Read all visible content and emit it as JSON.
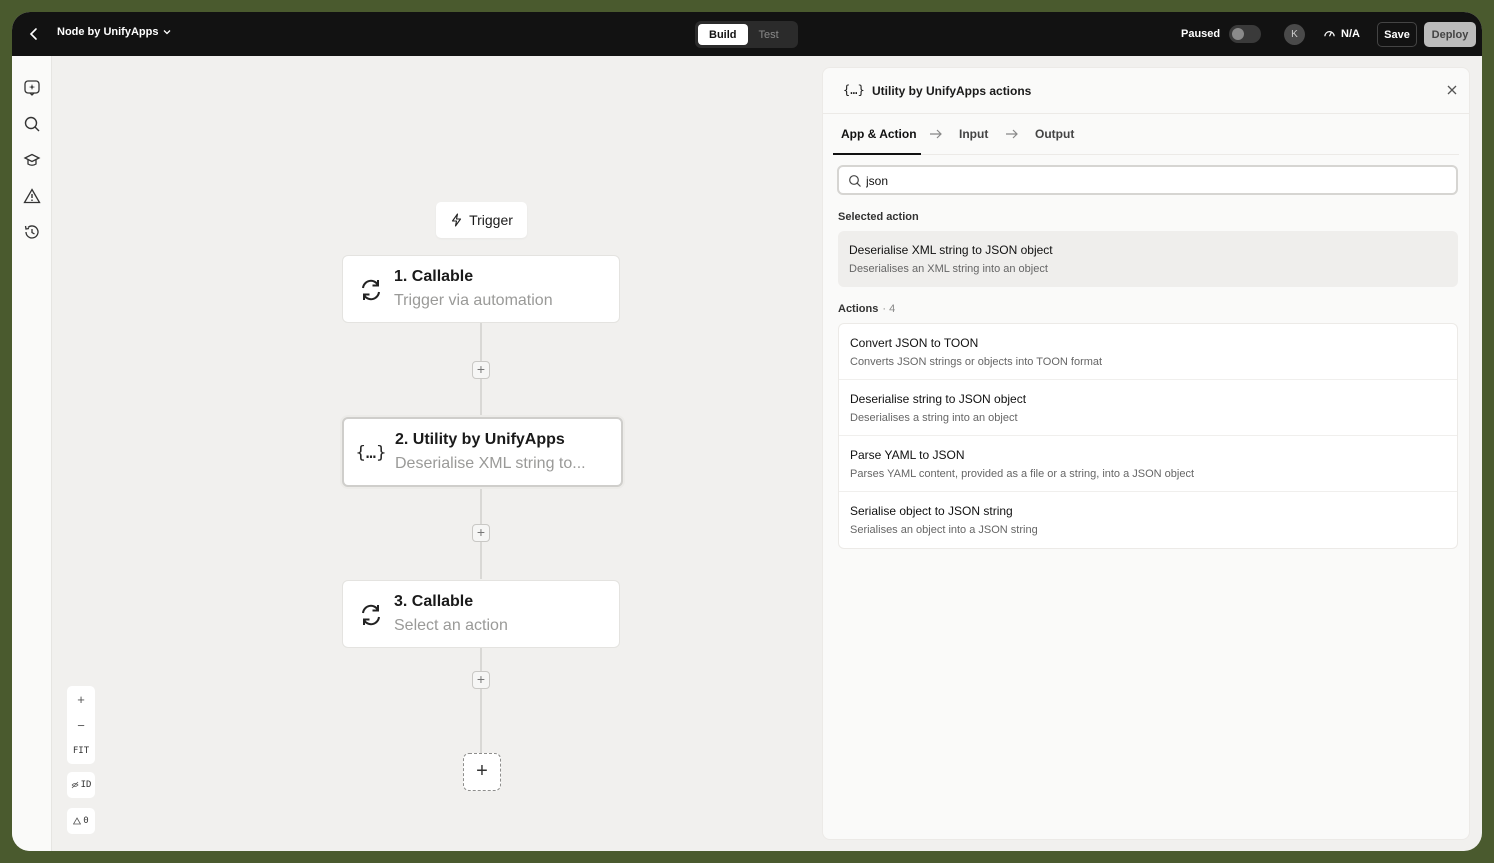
{
  "topbar": {
    "app_title": "Node by UnifyApps",
    "modes": [
      "Build",
      "Test"
    ],
    "paused_label": "Paused",
    "avatar_initial": "K",
    "perf_label": "N/A",
    "save_label": "Save",
    "deploy_label": "Deploy"
  },
  "rail": {
    "icons": [
      "sparkle-chat-icon",
      "search-icon",
      "graduation-cap-icon",
      "warning-icon",
      "history-icon"
    ]
  },
  "canvas": {
    "trigger_label": "Trigger",
    "nodes": [
      {
        "title": "1. Callable",
        "subtitle": "Trigger via automation",
        "icon": "sync-icon"
      },
      {
        "title": "2. Utility by UnifyApps",
        "subtitle": "Deserialise XML string to...",
        "icon": "braces-icon"
      },
      {
        "title": "3. Callable",
        "subtitle": "Select an action",
        "icon": "sync-icon"
      }
    ],
    "zoom_in": "+",
    "zoom_out": "−",
    "fit_label": "FIT",
    "id_label": "ID",
    "warnings_count": "0"
  },
  "panel": {
    "brace_glyph": "{…}",
    "title": "Utility by UnifyApps actions",
    "tabs": [
      "App & Action",
      "Input",
      "Output"
    ],
    "search": {
      "value": "json",
      "placeholder": ""
    },
    "selected_label": "Selected action",
    "selected_action": {
      "title": "Deserialise XML string to JSON object",
      "desc": "Deserialises an XML string into an object"
    },
    "actions_label": "Actions",
    "actions_count": "4",
    "actions": [
      {
        "title": "Convert JSON to TOON",
        "desc": "Converts JSON strings or objects into TOON format"
      },
      {
        "title": "Deserialise string to JSON object",
        "desc": "Deserialises a string into an object"
      },
      {
        "title": "Parse YAML to JSON",
        "desc": "Parses YAML content, provided as a file or a string, into a JSON object"
      },
      {
        "title": "Serialise object to JSON string",
        "desc": "Serialises an object into a JSON string"
      }
    ]
  }
}
